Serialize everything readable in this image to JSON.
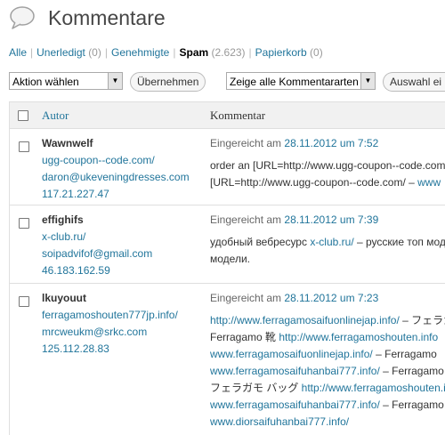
{
  "header": {
    "title": "Kommentare",
    "icon": "speech-bubble-icon"
  },
  "filters": [
    {
      "label": "Alle",
      "count": ""
    },
    {
      "label": "Unerledigt",
      "count": "(0)"
    },
    {
      "label": "Genehmigte",
      "count": ""
    },
    {
      "label": "Spam",
      "count": "(2.623)",
      "current": true
    },
    {
      "label": "Papierkorb",
      "count": "(0)"
    }
  ],
  "tablenav": {
    "bulk_action": "Aktion wählen",
    "apply": "Übernehmen",
    "comment_type": "Zeige alle Kommentararten",
    "filter": "Auswahl ei"
  },
  "columns": {
    "author": "Autor",
    "comment": "Kommentar"
  },
  "rows": [
    {
      "name": "Wawnwelf",
      "url": "ugg-coupon--code.com/",
      "email": "daron@ukeveningdresses.com",
      "ip": "117.21.227.47",
      "submitted_prefix": "Eingereicht am",
      "date": "28.11.2012 um 7:52",
      "lines": [
        [
          {
            "t": "order an [URL=http://www.ugg-coupon--code.com",
            "link": false
          }
        ],
        [
          {
            "t": "[URL=http://www.ugg-coupon--code.com/ – ",
            "link": false
          },
          {
            "t": "www",
            "link": true
          }
        ]
      ]
    },
    {
      "name": "effighifs",
      "url": "x-club.ru/",
      "email": "soipadvifof@gmail.com",
      "ip": "46.183.162.59",
      "submitted_prefix": "Eingereicht am",
      "date": "28.11.2012 um 7:39",
      "lines": [
        [
          {
            "t": "удобный вебресурс ",
            "link": false
          },
          {
            "t": "x-club.ru/",
            "link": true
          },
          {
            "t": " – русские топ моде",
            "link": false
          }
        ],
        [
          {
            "t": "модели.",
            "link": false
          }
        ]
      ]
    },
    {
      "name": "lkuyouut",
      "url": "ferragamoshouten777jp.info/",
      "email": "mrcweukm@srkc.com",
      "ip": "125.112.28.83",
      "submitted_prefix": "Eingereicht am",
      "date": "28.11.2012 um 7:23",
      "lines": [
        [
          {
            "t": "http://www.ferragamosaifuonlinejap.info/",
            "link": true
          },
          {
            "t": " – フェラガ",
            "link": false
          }
        ],
        [
          {
            "t": "Ferragamo 靴 ",
            "link": false
          },
          {
            "t": "http://www.ferragamoshouten.info",
            "link": true
          }
        ],
        [
          {
            "t": "www.ferragamosaifuonlinejap.info/",
            "link": true
          },
          {
            "t": " – Ferragamo",
            "link": false
          }
        ],
        [
          {
            "t": "www.ferragamosaifuhanbai777.info/",
            "link": true
          },
          {
            "t": " – Ferragamo",
            "link": false
          }
        ],
        [
          {
            "t": "フェラガモ バッグ ",
            "link": false
          },
          {
            "t": "http://www.ferragamoshouten.inf",
            "link": true
          }
        ],
        [
          {
            "t": "www.ferragamosaifuhanbai777.info/",
            "link": true
          },
          {
            "t": " – Ferragamo",
            "link": false
          }
        ],
        [
          {
            "t": "www.diorsaifuhanbai777.info/",
            "link": true
          }
        ]
      ]
    }
  ]
}
